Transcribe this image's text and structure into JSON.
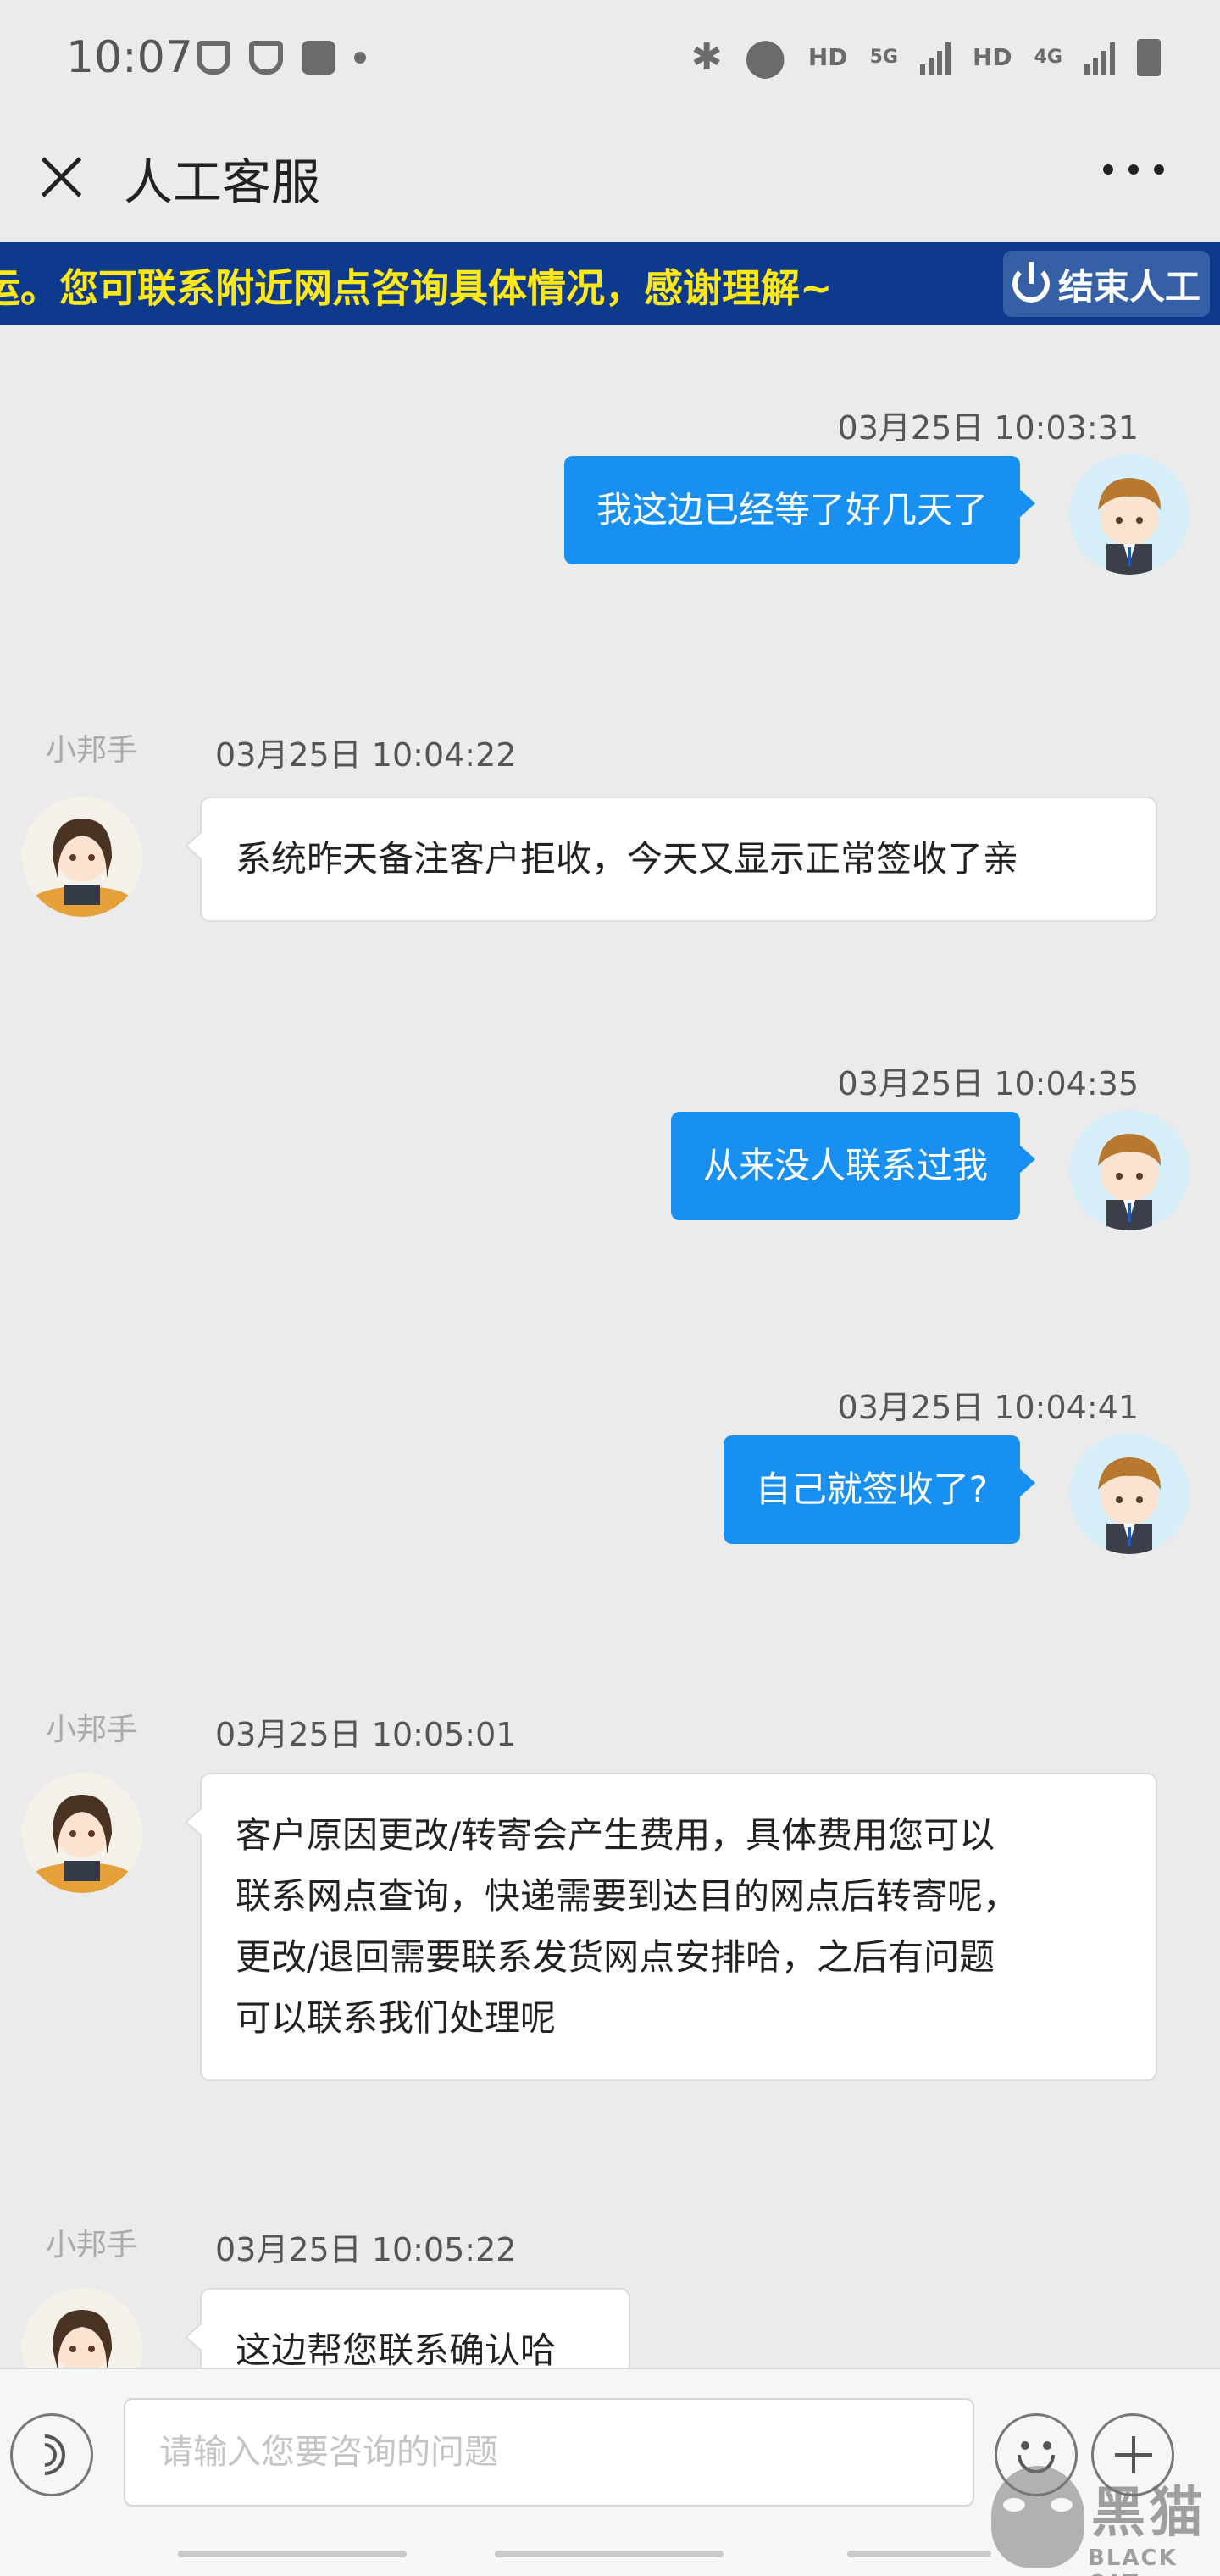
{
  "status_bar": {
    "time": "10:07",
    "hd1": "HD",
    "net1": "5G",
    "hd2": "HD",
    "net2": "4G"
  },
  "header": {
    "title": "人工客服"
  },
  "banner": {
    "text": "运。您可联系附近网点咨询具体情况，感谢理解~",
    "end_button": "结束人工"
  },
  "messages": [
    {
      "side": "out",
      "time": "03月25日 10:03:31",
      "text": "我这边已经等了好几天了"
    },
    {
      "side": "in",
      "sender": "小邦手",
      "time": "03月25日 10:04:22",
      "lines": [
        "系统昨天备注客户拒收，今天又显示正常签收了亲"
      ]
    },
    {
      "side": "out",
      "time": "03月25日 10:04:35",
      "text": "从来没人联系过我"
    },
    {
      "side": "out",
      "time": "03月25日 10:04:41",
      "text": "自己就签收了?"
    },
    {
      "side": "in",
      "sender": "小邦手",
      "time": "03月25日 10:05:01",
      "lines": [
        "客户原因更改/转寄会产生费用，具体费用您可以",
        "联系网点查询，快递需要到达目的网点后转寄呢，",
        "更改/退回需要联系发货网点安排哈，之后有问题",
        "可以联系我们处理呢"
      ]
    },
    {
      "side": "in",
      "sender": "小邦手",
      "time": "03月25日 10:05:22",
      "lines": [
        "这边帮您联系确认哈"
      ]
    }
  ],
  "input": {
    "placeholder": "请输入您要咨询的问题"
  },
  "watermark": {
    "cn": "黑猫",
    "en": "BLACK CAT"
  },
  "colors": {
    "outgoing_bubble": "#1890f2",
    "banner_bg": "#0e3a8e",
    "banner_text": "#ffe817"
  }
}
